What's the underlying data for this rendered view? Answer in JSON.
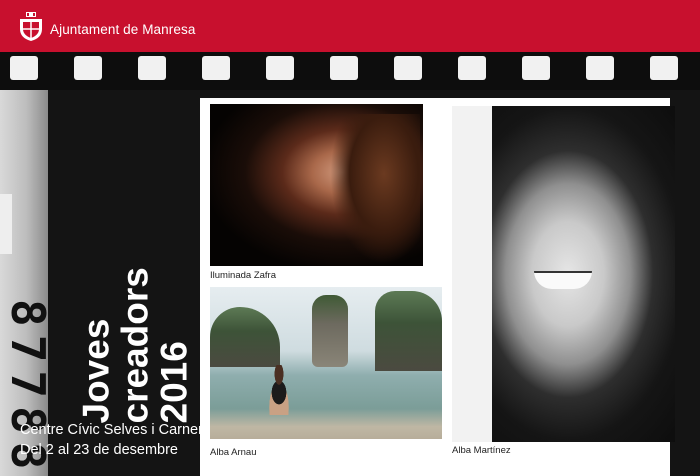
{
  "header": {
    "brand": "Ajuntament de Manresa",
    "color": "#c8102e",
    "logo_icon": "manresa-coat-of-arms-icon"
  },
  "film_edge": {
    "number": "87788"
  },
  "title": {
    "line1": "Joves creadors",
    "line2": "2016"
  },
  "venue": {
    "line1": "Centre Cívic Selves i Carner",
    "line2": "Del 2 al 23 de desembre"
  },
  "photos": [
    {
      "caption": "Iluminada Zafra"
    },
    {
      "caption": "Alba Arnau"
    },
    {
      "caption": "Alba Martínez"
    }
  ]
}
